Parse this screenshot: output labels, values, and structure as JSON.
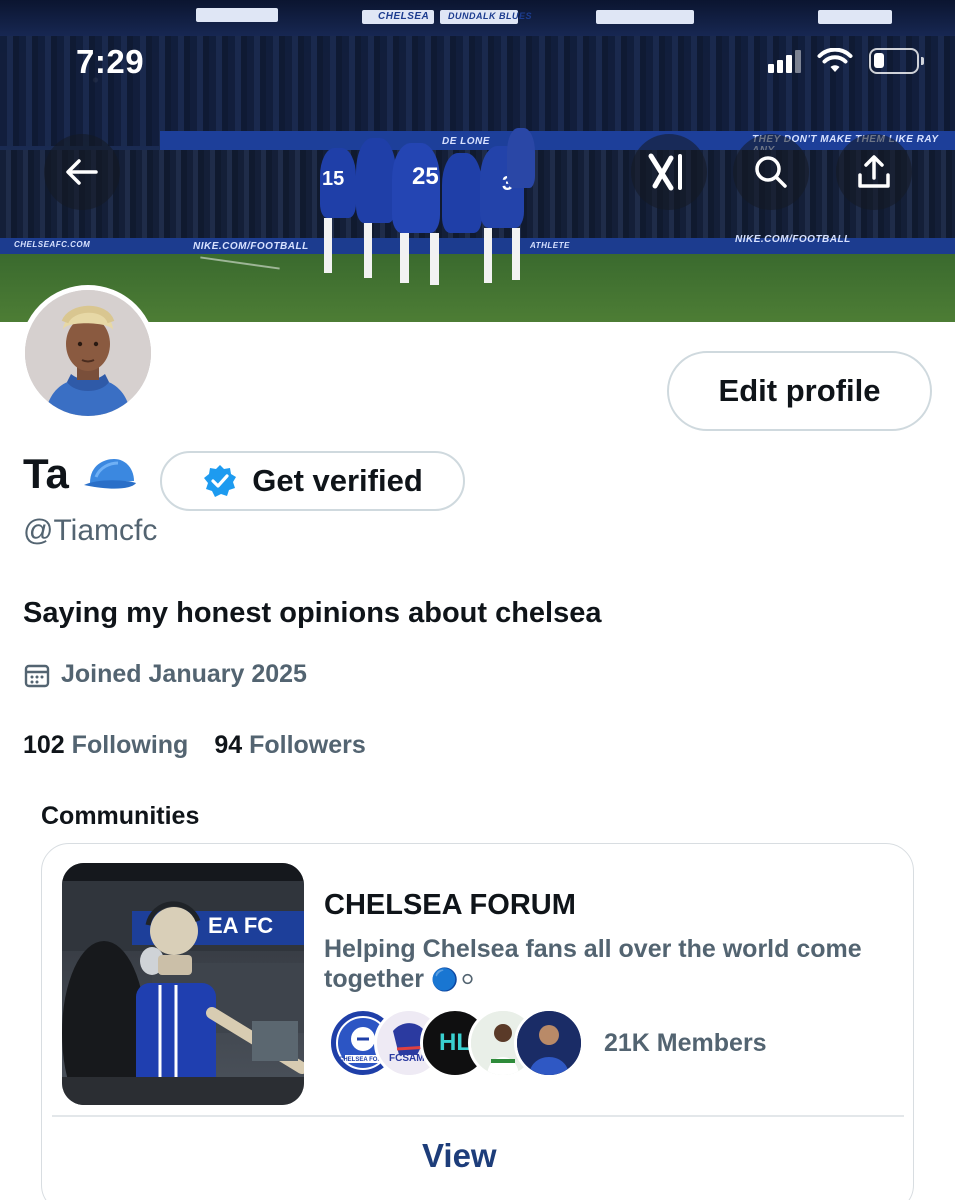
{
  "status_bar": {
    "time": "7:29"
  },
  "banner": {
    "ad_texts": [
      "NIKE.COM/FOOTBALL",
      "NIKE.COM/FOOTBALL",
      "CHELSEAFC.COM",
      "ATHLETE",
      "THEY DON'T MAKE THEM LIKE RAY ANY",
      "DE LONE",
      "CHELSEA",
      "DUNDALK BLUES"
    ],
    "shirt_numbers": [
      "15",
      "25",
      "3"
    ]
  },
  "header_actions": {
    "back": "back-arrow-icon",
    "grok": "grok-icon",
    "search": "search-icon",
    "share": "share-icon"
  },
  "profile": {
    "display_name": "Ta",
    "emoji": "blue-cap-icon",
    "verify_label": "Get verified",
    "edit_label": "Edit profile",
    "handle": "@Tiamcfc",
    "bio": "Saying my honest opinions about chelsea",
    "joined": "Joined January 2025",
    "following_count": "102",
    "following_label": "Following",
    "followers_count": "94",
    "followers_label": "Followers"
  },
  "communities": {
    "title": "Communities",
    "card": {
      "image_text": "EA FC",
      "name": "CHELSEA FORUM",
      "description": "Helping Chelsea fans all over the world come together",
      "emoji": "🔵⚪",
      "members": "21K Members",
      "view_label": "View",
      "member_avatar_texts": [
        "CHELSEA FORUM",
        "FCSAM",
        "HL"
      ]
    }
  },
  "colors": {
    "text_primary": "#0f1419",
    "text_secondary": "#536471",
    "border": "#cfd9de",
    "verify_blue": "#1d9bf0",
    "chelsea_blue": "#1f3fa8",
    "view_text": "#1d3d7a"
  }
}
